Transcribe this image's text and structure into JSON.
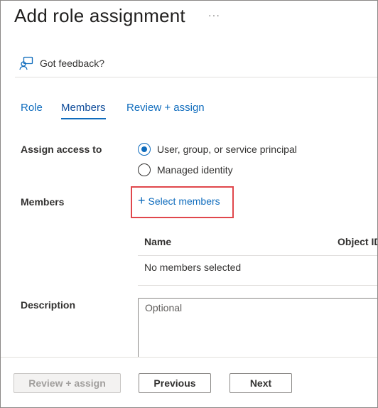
{
  "header": {
    "title": "Add role assignment",
    "more_label": "···",
    "feedback_label": "Got feedback?"
  },
  "tabs": [
    {
      "label": "Role",
      "active": false
    },
    {
      "label": "Members",
      "active": true
    },
    {
      "label": "Review + assign",
      "active": false
    }
  ],
  "assign_access": {
    "label": "Assign access to",
    "options": [
      {
        "label": "User, group, or service principal",
        "checked": true
      },
      {
        "label": "Managed identity",
        "checked": false
      }
    ]
  },
  "members": {
    "label": "Members",
    "select_label": "Select members",
    "columns": [
      "Name",
      "Object ID"
    ],
    "empty_text": "No members selected"
  },
  "description": {
    "label": "Description",
    "placeholder": "Optional"
  },
  "footer": {
    "review_label": "Review + assign",
    "previous_label": "Previous",
    "next_label": "Next"
  },
  "colors": {
    "accent": "#0f6cbd",
    "highlight_border": "#e0474c"
  }
}
